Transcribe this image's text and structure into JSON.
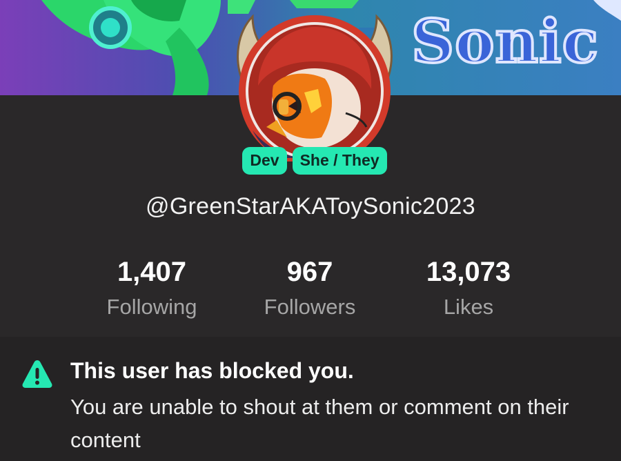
{
  "banner": {
    "text": "Sonic"
  },
  "profile": {
    "badges": [
      "Dev",
      "She / They"
    ],
    "username": "@GreenStarAKAToySonic2023"
  },
  "stats": [
    {
      "value": "1,407",
      "label": "Following"
    },
    {
      "value": "967",
      "label": "Followers"
    },
    {
      "value": "13,073",
      "label": "Likes"
    }
  ],
  "notice": {
    "icon": "warning-icon",
    "title": "This user has blocked you.",
    "body": "You are unable to shout at them or comment on their content"
  },
  "colors": {
    "accent": "#25e8b2",
    "background": "#2a2829",
    "notice_background": "#252324"
  }
}
